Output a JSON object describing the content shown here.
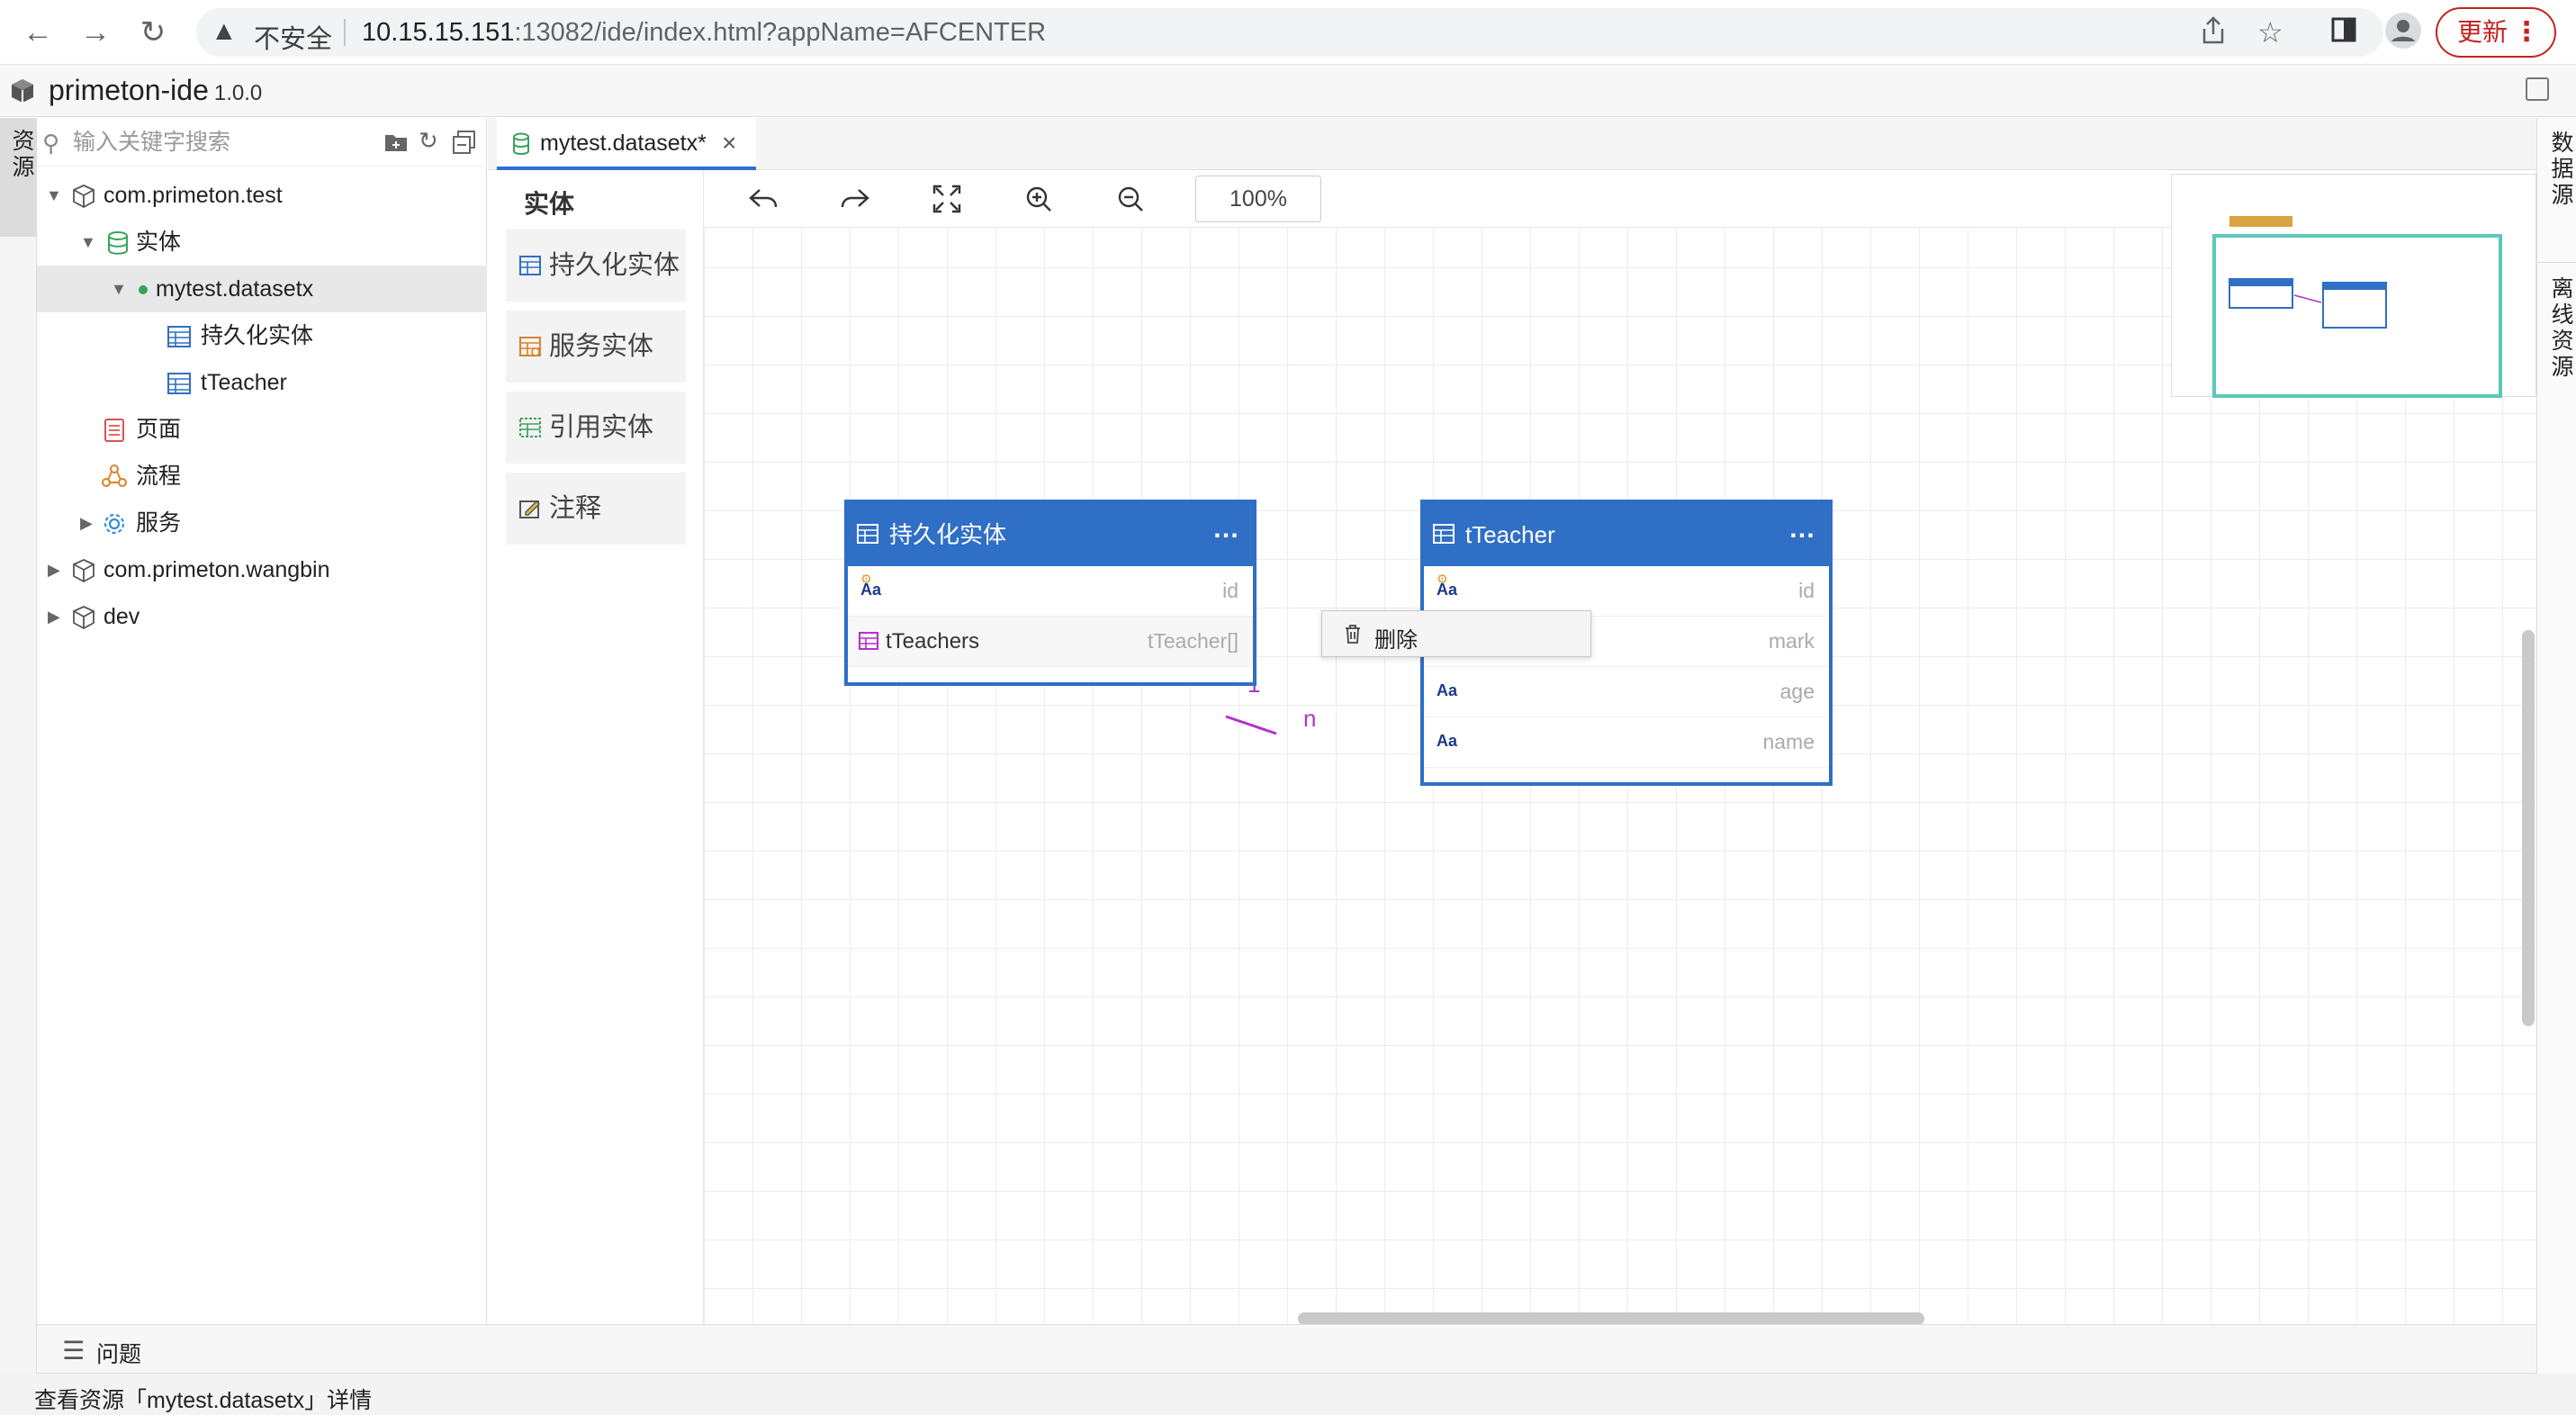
{
  "browser": {
    "security_label": "不安全",
    "url_host": "10.15.15.151",
    "url_path": ":13082/ide/index.html?appName=AFCENTER",
    "update_label": "更新"
  },
  "app": {
    "name": "primeton-ide",
    "version": "1.0.0"
  },
  "left_tab": {
    "label": "资源"
  },
  "right_tabs": [
    {
      "label": "数据源"
    },
    {
      "label": "离线资源"
    }
  ],
  "search": {
    "placeholder": "输入关键字搜索"
  },
  "tree": [
    {
      "label": "com.primeton.test",
      "icon": "package-icon"
    },
    {
      "label": "实体",
      "icon": "database-icon"
    },
    {
      "label": "mytest.datasetx",
      "icon": "dot-icon",
      "selected": true
    },
    {
      "label": "持久化实体",
      "icon": "table-icon"
    },
    {
      "label": "tTeacher",
      "icon": "table-icon"
    },
    {
      "label": "页面",
      "icon": "page-icon"
    },
    {
      "label": "流程",
      "icon": "flow-icon"
    },
    {
      "label": "服务",
      "icon": "gear-icon"
    },
    {
      "label": "com.primeton.wangbin",
      "icon": "package-icon"
    },
    {
      "label": "dev",
      "icon": "package-icon"
    }
  ],
  "editor_tab": {
    "label": "mytest.datasetx*"
  },
  "palette": {
    "title": "实体",
    "items": [
      {
        "label": "持久化实体",
        "icon": "persist-entity-icon",
        "color": "#2f6fc6"
      },
      {
        "label": "服务实体",
        "icon": "service-entity-icon",
        "color": "#d9822b"
      },
      {
        "label": "引用实体",
        "icon": "ref-entity-icon",
        "color": "#3aa35d"
      },
      {
        "label": "注释",
        "icon": "note-icon",
        "color": "#555555"
      }
    ]
  },
  "toolbar": {
    "zoom": "100%"
  },
  "entities": [
    {
      "title": "持久化实体",
      "fields": [
        {
          "type": "Aa",
          "name": "id",
          "key": true
        },
        {
          "label": "tTeachers",
          "name": "tTeacher[]"
        }
      ]
    },
    {
      "title": "tTeacher",
      "fields": [
        {
          "type": "Aa",
          "name": "id",
          "key": true
        },
        {
          "type": "Aa",
          "name": "mark"
        },
        {
          "type": "Aa",
          "name": "age"
        },
        {
          "type": "Aa",
          "name": "name"
        }
      ]
    }
  ],
  "relation": {
    "from_label": "1",
    "to_label": "n",
    "color": "#b233c9"
  },
  "context_menu": {
    "delete_label": "删除"
  },
  "problems": {
    "label": "问题"
  },
  "status": {
    "text": "查看资源「mytest.datasetx」详情"
  },
  "colors": {
    "accent": "#2f6fc6",
    "danger": "#c5221f"
  }
}
